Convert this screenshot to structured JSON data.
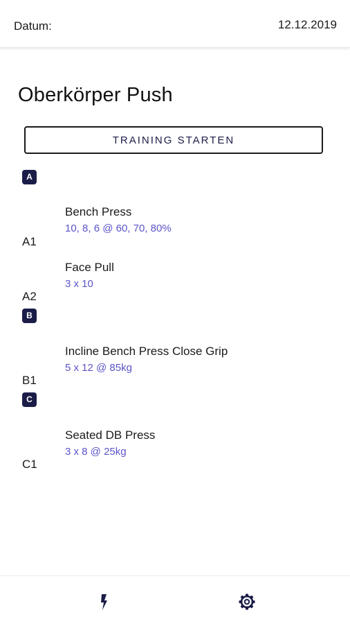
{
  "header": {
    "date_label": "Datum:",
    "date_value": "12.12.2019"
  },
  "workout": {
    "title": "Oberkörper Push",
    "start_button_label": "TRAINING STARTEN"
  },
  "groups": [
    {
      "badge": "A",
      "exercises": [
        {
          "code": "A1",
          "name": "Bench Press",
          "scheme": "10, 8, 6 @ 60, 70, 80%"
        },
        {
          "code": "A2",
          "name": "Face Pull",
          "scheme": "3 x 10"
        }
      ]
    },
    {
      "badge": "B",
      "exercises": [
        {
          "code": "B1",
          "name": "Incline Bench Press Close Grip",
          "scheme": "5 x 12 @ 85kg"
        }
      ]
    },
    {
      "badge": "C",
      "exercises": [
        {
          "code": "C1",
          "name": "Seated DB Press",
          "scheme": "3 x 8 @ 25kg"
        }
      ]
    }
  ],
  "bottom_nav": {
    "items": [
      {
        "icon": "lightning-icon"
      },
      {
        "icon": "gear-icon"
      }
    ]
  },
  "colors": {
    "accent_dark": "#1b1d48",
    "scheme_text": "#5b54c8"
  }
}
